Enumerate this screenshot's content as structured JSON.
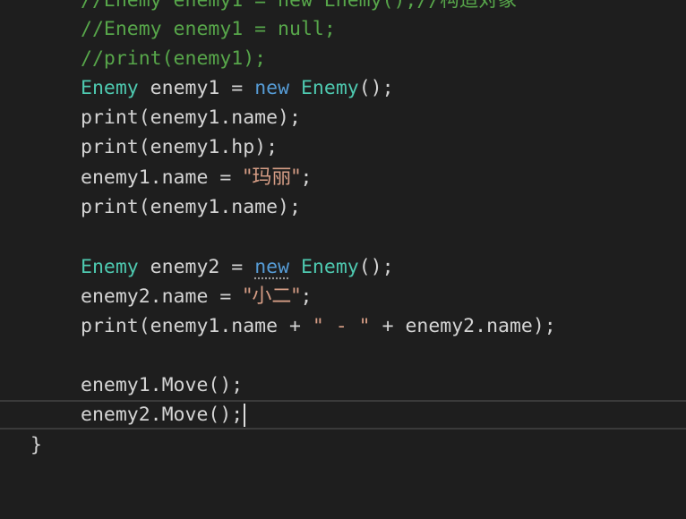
{
  "editor": {
    "lines": [
      {
        "text": "//Enemy enemy1 = new Enemy();//构造对象"
      },
      {
        "text": "//Enemy enemy1 = null;"
      },
      {
        "text": "//print(enemy1);"
      },
      {
        "t1": "Enemy",
        "t2": " enemy1 = ",
        "t3": "new",
        "t4": " ",
        "t5": "Enemy",
        "t6": "();"
      },
      {
        "text": "print(enemy1.name);"
      },
      {
        "text": "print(enemy1.hp);"
      },
      {
        "t1": "enemy1.name = ",
        "t2": "\"玛丽\"",
        "t3": ";"
      },
      {
        "text": "print(enemy1.name);"
      },
      {
        "text": ""
      },
      {
        "t1": "Enemy",
        "t2": " enemy2 = ",
        "t3": "new",
        "t4": " ",
        "t5": "Enemy",
        "t6": "();"
      },
      {
        "t1": "enemy2.name = ",
        "t2": "\"小二\"",
        "t3": ";"
      },
      {
        "t1": "print(enemy1.name + ",
        "t2": "\" - \"",
        "t3": " + enemy2.name);"
      },
      {
        "text": ""
      },
      {
        "text": "enemy1.Move();"
      },
      {
        "text": "enemy2.Move();"
      },
      {
        "text": "}"
      }
    ]
  },
  "colors": {
    "background": "#1e1e1e",
    "default_text": "#d4d4d4",
    "comment": "#57a64a",
    "type": "#4ec9b0",
    "keyword": "#569cd6",
    "string": "#d69d85"
  }
}
